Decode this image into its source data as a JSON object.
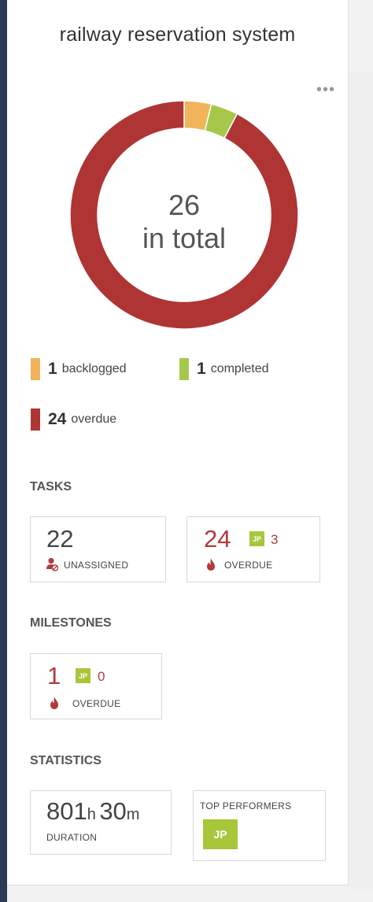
{
  "title": "railway reservation system",
  "more_icon": "more-horizontal-icon",
  "colors": {
    "accent_bar": "#2b3a55",
    "backlogged": "#f0b45a",
    "completed": "#a6c84a",
    "overdue": "#ae3534",
    "overdue_text": "#b23a3a",
    "avatar": "#a8c63a"
  },
  "donut": {
    "total": "26",
    "caption": "in total",
    "segments": [
      {
        "name": "backlogged",
        "value": 1,
        "color": "#f0b45a"
      },
      {
        "name": "completed",
        "value": 1,
        "color": "#a6c84a"
      },
      {
        "name": "overdue",
        "value": 24,
        "color": "#ae3534"
      }
    ]
  },
  "legend": [
    {
      "count": "1",
      "label": "backlogged",
      "color": "#f0b45a"
    },
    {
      "count": "1",
      "label": "completed",
      "color": "#a6c84a"
    },
    {
      "count": "24",
      "label": "overdue",
      "color": "#ae3534"
    }
  ],
  "tasks": {
    "heading": "TASKS",
    "unassigned": {
      "value": "22",
      "label": "UNASSIGNED",
      "icon": "user-blocked-icon"
    },
    "overdue": {
      "value": "24",
      "label": "OVERDUE",
      "icon": "flame-icon",
      "avatar": "JP",
      "avatar_count": "3"
    }
  },
  "milestones": {
    "heading": "MILESTONES",
    "overdue": {
      "value": "1",
      "label": "OVERDUE",
      "icon": "flame-icon",
      "avatar": "JP",
      "avatar_count": "0"
    }
  },
  "statistics": {
    "heading": "STATISTICS",
    "duration": {
      "hours": "801",
      "hours_unit": "h",
      "minutes": "30",
      "minutes_unit": "m",
      "label": "DURATION"
    },
    "top_performers": {
      "label": "TOP PERFORMERS",
      "avatar": "JP"
    }
  }
}
